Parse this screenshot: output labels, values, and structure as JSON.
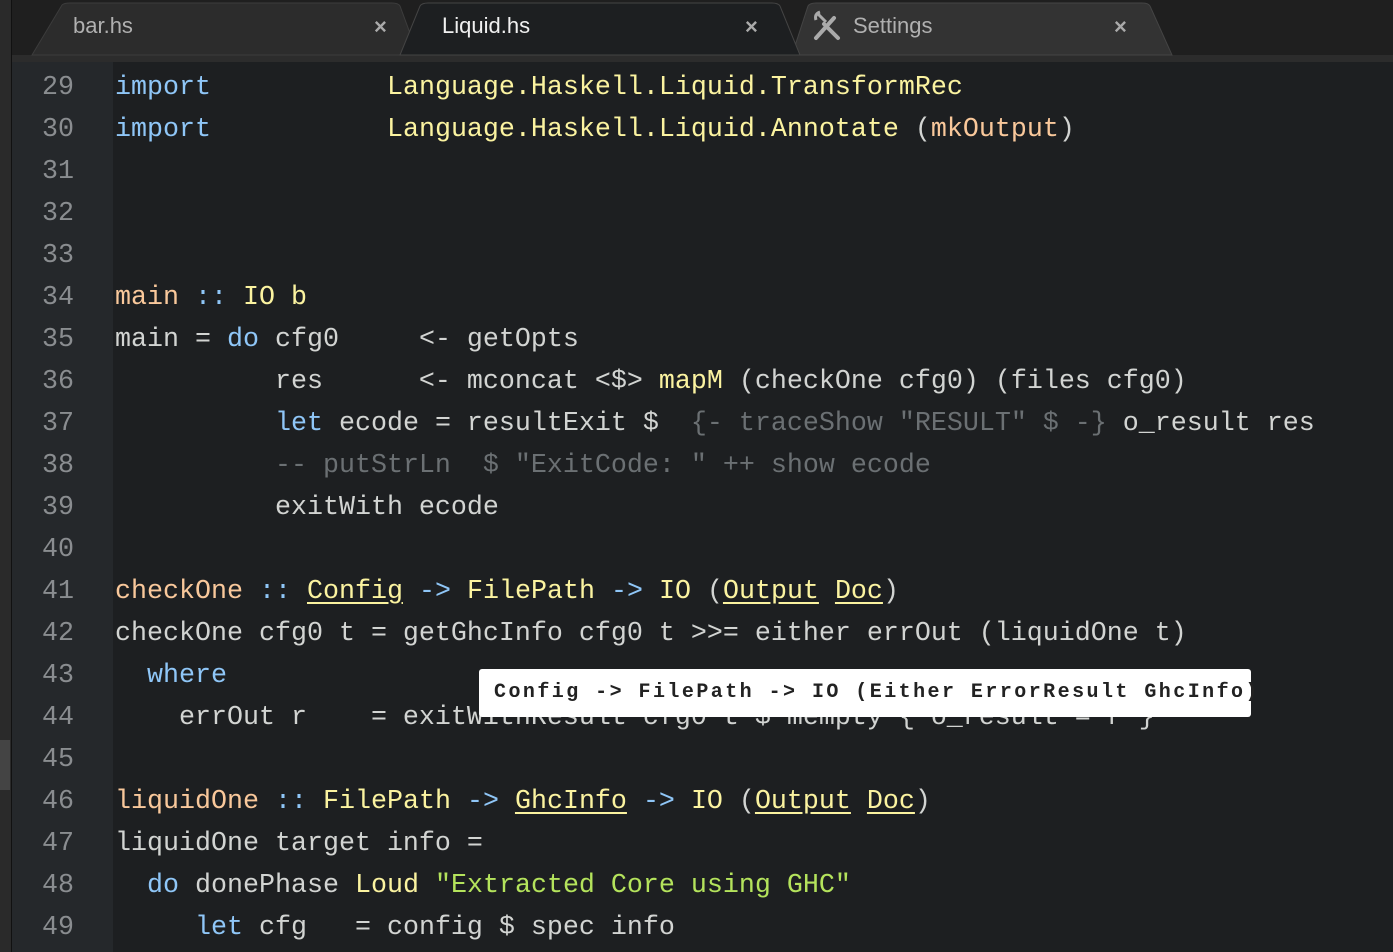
{
  "tabs": [
    {
      "label": "bar.hs",
      "active": false
    },
    {
      "label": "Liquid.hs",
      "active": true
    },
    {
      "label": "Settings",
      "active": false,
      "icon": "tools-icon"
    }
  ],
  "close_glyph": "×",
  "colors": {
    "background": "#1d1f21",
    "gutter": "#25282b",
    "keyword": "#8fc6f7",
    "type": "#fbf3a0",
    "function": "#f9c89b",
    "string": "#b4e35c",
    "comment": "#6b7073"
  },
  "lines": [
    {
      "n": "29",
      "tokens": [
        {
          "t": "import",
          "c": "kw"
        },
        {
          "t": "           "
        },
        {
          "t": "Language.Haskell.Liquid.TransformRec",
          "c": "ty"
        }
      ]
    },
    {
      "n": "30",
      "tokens": [
        {
          "t": "import",
          "c": "kw"
        },
        {
          "t": "           "
        },
        {
          "t": "Language.Haskell.Liquid.Annotate",
          "c": "ty"
        },
        {
          "t": " ("
        },
        {
          "t": "mkOutput",
          "c": "fn"
        },
        {
          "t": ")"
        }
      ]
    },
    {
      "n": "31",
      "tokens": []
    },
    {
      "n": "32",
      "tokens": []
    },
    {
      "n": "33",
      "tokens": []
    },
    {
      "n": "34",
      "tokens": [
        {
          "t": "main",
          "c": "fn"
        },
        {
          "t": " "
        },
        {
          "t": "::",
          "c": "op"
        },
        {
          "t": " "
        },
        {
          "t": "IO",
          "c": "ty"
        },
        {
          "t": " "
        },
        {
          "t": "b",
          "c": "ty"
        }
      ]
    },
    {
      "n": "35",
      "tokens": [
        {
          "t": "main = "
        },
        {
          "t": "do",
          "c": "kw"
        },
        {
          "t": " cfg0     <- getOpts"
        }
      ]
    },
    {
      "n": "36",
      "tokens": [
        {
          "t": "          res      <- mconcat <$> "
        },
        {
          "t": "mapM",
          "c": "ty"
        },
        {
          "t": " (checkOne cfg0) (files cfg0)"
        }
      ]
    },
    {
      "n": "37",
      "tokens": [
        {
          "t": "          "
        },
        {
          "t": "let",
          "c": "kw"
        },
        {
          "t": " ecode = resultExit $  "
        },
        {
          "t": "{- traceShow \"RESULT\" $ -}",
          "c": "cm"
        },
        {
          "t": " o_result res"
        }
      ]
    },
    {
      "n": "38",
      "tokens": [
        {
          "t": "          "
        },
        {
          "t": "-- putStrLn  $ \"ExitCode: \" ++ show ecode",
          "c": "cm"
        }
      ]
    },
    {
      "n": "39",
      "tokens": [
        {
          "t": "          exitWith ecode"
        }
      ]
    },
    {
      "n": "40",
      "tokens": []
    },
    {
      "n": "41",
      "tokens": [
        {
          "t": "checkOne",
          "c": "fn"
        },
        {
          "t": " "
        },
        {
          "t": "::",
          "c": "op"
        },
        {
          "t": " "
        },
        {
          "t": "Config",
          "c": "ty u"
        },
        {
          "t": " "
        },
        {
          "t": "->",
          "c": "op"
        },
        {
          "t": " "
        },
        {
          "t": "FilePath",
          "c": "ty"
        },
        {
          "t": " "
        },
        {
          "t": "->",
          "c": "op"
        },
        {
          "t": " "
        },
        {
          "t": "IO",
          "c": "ty"
        },
        {
          "t": " ("
        },
        {
          "t": "Output",
          "c": "ty u"
        },
        {
          "t": " "
        },
        {
          "t": "Doc",
          "c": "ty u"
        },
        {
          "t": ")"
        }
      ]
    },
    {
      "n": "42",
      "tokens": [
        {
          "t": "checkOne cfg0 t = getGhcInfo cfg0 t >>= either errOut (liquidOne t)"
        }
      ]
    },
    {
      "n": "43",
      "tokens": [
        {
          "t": "  "
        },
        {
          "t": "where",
          "c": "kw"
        }
      ]
    },
    {
      "n": "44",
      "tokens": [
        {
          "t": "    errOut r    = exitWithResult cfg0 t $ mempty { o_result = r }"
        }
      ]
    },
    {
      "n": "45",
      "tokens": []
    },
    {
      "n": "46",
      "tokens": [
        {
          "t": "liquidOne",
          "c": "fn"
        },
        {
          "t": " "
        },
        {
          "t": "::",
          "c": "op"
        },
        {
          "t": " "
        },
        {
          "t": "FilePath",
          "c": "ty"
        },
        {
          "t": " "
        },
        {
          "t": "->",
          "c": "op"
        },
        {
          "t": " "
        },
        {
          "t": "GhcInfo",
          "c": "ty u"
        },
        {
          "t": " "
        },
        {
          "t": "->",
          "c": "op"
        },
        {
          "t": " "
        },
        {
          "t": "IO",
          "c": "ty"
        },
        {
          "t": " ("
        },
        {
          "t": "Output",
          "c": "ty u"
        },
        {
          "t": " "
        },
        {
          "t": "Doc",
          "c": "ty u"
        },
        {
          "t": ")"
        }
      ]
    },
    {
      "n": "47",
      "tokens": [
        {
          "t": "liquidOne target info ="
        }
      ]
    },
    {
      "n": "48",
      "tokens": [
        {
          "t": "  "
        },
        {
          "t": "do",
          "c": "kw"
        },
        {
          "t": " donePhase "
        },
        {
          "t": "Loud",
          "c": "ty"
        },
        {
          "t": " "
        },
        {
          "t": "\"Extracted Core using GHC\"",
          "c": "str"
        }
      ]
    },
    {
      "n": "49",
      "tokens": [
        {
          "t": "     "
        },
        {
          "t": "let",
          "c": "kw"
        },
        {
          "t": " cfg   = config $ spec info"
        }
      ]
    }
  ],
  "tooltip": {
    "text": "Config -> FilePath -> IO (Either ErrorResult GhcInfo)"
  }
}
